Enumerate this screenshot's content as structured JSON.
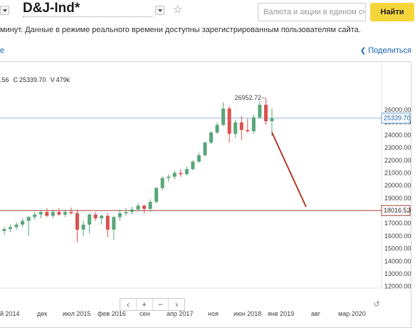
{
  "header": {
    "title": "D&J-Ind*",
    "search_placeholder": "Валюта и акции в едином сч",
    "find_label": "Найти",
    "star_icon": "star-icon"
  },
  "notice": "минут. Данные в режиме реального времени доступны зарегистрированным пользователям сайта.",
  "tab_fragment": "е",
  "share_label": "Поделиться",
  "ohlc": {
    "prefix": ".56",
    "c_label": "C",
    "c_value": "25339.70",
    "v_label": "V",
    "v_value": "479k"
  },
  "zoom": {
    "prev": "‹",
    "plus": "+",
    "minus": "−",
    "next": "›"
  },
  "colors": {
    "up": "#5aa77a",
    "down": "#d9534f",
    "accent": "#1a64b0",
    "trend": "#b5412c",
    "button": "#f5d63a"
  },
  "chart_data": {
    "type": "candlestick",
    "x_tick_labels": [
      "й 2014",
      "дек",
      "июл 2015",
      "фев 2016",
      "сен",
      "апр 2017",
      "ноя",
      "июн 2018",
      "янв 2019",
      "авг",
      "мар 2020"
    ],
    "y_tick_labels": [
      "26000.00",
      "25000.00",
      "24000.00",
      "23000.00",
      "22000.00",
      "21000.00",
      "20000.00",
      "19000.00",
      "18000.00",
      "17000.00",
      "16000.00",
      "15000.00",
      "14000.00",
      "13000.00",
      "12000.00"
    ],
    "ylim": [
      11700,
      27200
    ],
    "max_label": "26952.72",
    "current_price": 25339.7,
    "current_label": "25339.70",
    "line_level": 18016.52,
    "line_label": "18016.52",
    "trend_line": {
      "from": [
        "2019-01",
        24200
      ],
      "to": [
        "2019-08",
        18300
      ]
    },
    "candles": [
      {
        "o": 16400,
        "h": 16700,
        "l": 16100,
        "c": 16550
      },
      {
        "o": 16550,
        "h": 16900,
        "l": 16300,
        "c": 16700
      },
      {
        "o": 16700,
        "h": 17100,
        "l": 16500,
        "c": 16900
      },
      {
        "o": 16900,
        "h": 17400,
        "l": 16700,
        "c": 17200
      },
      {
        "o": 17200,
        "h": 17600,
        "l": 16000,
        "c": 17500
      },
      {
        "o": 17500,
        "h": 17900,
        "l": 17300,
        "c": 17700
      },
      {
        "o": 17700,
        "h": 18100,
        "l": 17400,
        "c": 17900
      },
      {
        "o": 17900,
        "h": 18200,
        "l": 17500,
        "c": 17600
      },
      {
        "o": 17600,
        "h": 18100,
        "l": 17400,
        "c": 17900
      },
      {
        "o": 17900,
        "h": 18200,
        "l": 17600,
        "c": 17700
      },
      {
        "o": 17700,
        "h": 18100,
        "l": 17500,
        "c": 17900
      },
      {
        "o": 17900,
        "h": 18250,
        "l": 17700,
        "c": 17800
      },
      {
        "o": 17800,
        "h": 18100,
        "l": 15500,
        "c": 16500
      },
      {
        "o": 16500,
        "h": 17200,
        "l": 16000,
        "c": 16900
      },
      {
        "o": 16900,
        "h": 17800,
        "l": 16200,
        "c": 17700
      },
      {
        "o": 17700,
        "h": 17900,
        "l": 17200,
        "c": 17400
      },
      {
        "o": 17400,
        "h": 17700,
        "l": 16900,
        "c": 17600
      },
      {
        "o": 17600,
        "h": 17800,
        "l": 15900,
        "c": 16500
      },
      {
        "o": 16500,
        "h": 17600,
        "l": 15700,
        "c": 17500
      },
      {
        "o": 17500,
        "h": 18100,
        "l": 17200,
        "c": 17800
      },
      {
        "o": 17800,
        "h": 18200,
        "l": 17600,
        "c": 17900
      },
      {
        "o": 17900,
        "h": 18300,
        "l": 17700,
        "c": 18100
      },
      {
        "o": 18100,
        "h": 18600,
        "l": 17900,
        "c": 18400
      },
      {
        "o": 18400,
        "h": 18500,
        "l": 17800,
        "c": 18150
      },
      {
        "o": 18150,
        "h": 18900,
        "l": 17900,
        "c": 18700
      },
      {
        "o": 18700,
        "h": 19900,
        "l": 18600,
        "c": 19800
      },
      {
        "o": 19800,
        "h": 20700,
        "l": 19600,
        "c": 20600
      },
      {
        "o": 20600,
        "h": 20900,
        "l": 20300,
        "c": 20700
      },
      {
        "o": 20700,
        "h": 21200,
        "l": 20500,
        "c": 21000
      },
      {
        "o": 21000,
        "h": 21300,
        "l": 20700,
        "c": 20900
      },
      {
        "o": 20900,
        "h": 21500,
        "l": 20800,
        "c": 21300
      },
      {
        "o": 21300,
        "h": 22000,
        "l": 21200,
        "c": 21900
      },
      {
        "o": 21900,
        "h": 22600,
        "l": 21800,
        "c": 22400
      },
      {
        "o": 22400,
        "h": 23500,
        "l": 22300,
        "c": 23400
      },
      {
        "o": 23400,
        "h": 24300,
        "l": 23300,
        "c": 24200
      },
      {
        "o": 24200,
        "h": 25000,
        "l": 24100,
        "c": 24800
      },
      {
        "o": 24800,
        "h": 26600,
        "l": 24700,
        "c": 26100
      },
      {
        "o": 26100,
        "h": 26300,
        "l": 23400,
        "c": 24100
      },
      {
        "o": 24100,
        "h": 25200,
        "l": 23800,
        "c": 25000
      },
      {
        "o": 25000,
        "h": 25500,
        "l": 23600,
        "c": 24400
      },
      {
        "o": 24400,
        "h": 25300,
        "l": 24200,
        "c": 24300
      },
      {
        "o": 24300,
        "h": 25600,
        "l": 24100,
        "c": 25400
      },
      {
        "o": 25400,
        "h": 26700,
        "l": 25300,
        "c": 26400
      },
      {
        "o": 26400,
        "h": 26952.72,
        "l": 24800,
        "c": 25100
      },
      {
        "o": 25100,
        "h": 26100,
        "l": 23900,
        "c": 25339.7
      }
    ]
  }
}
